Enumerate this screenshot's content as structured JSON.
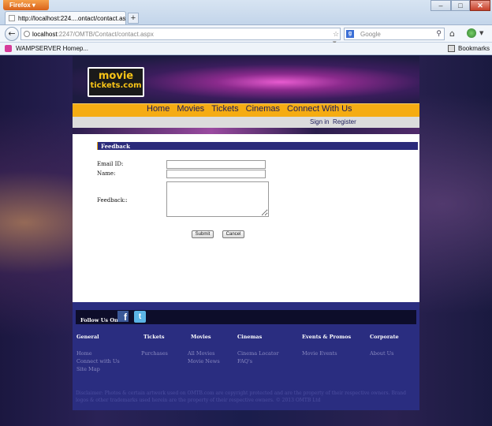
{
  "browser": {
    "menu_button": "Firefox",
    "tab_title": "http://localhost:224....ontact/contact.aspx",
    "new_tab": "+",
    "url_host": "localhost",
    "url_path": ":2247/OMTB/Contact/contact.aspx",
    "search_placeholder": "Google",
    "search_engine_icon": "google-icon",
    "bookmark_item": "WAMPSERVER Homep...",
    "bookmarks_label": "Bookmarks"
  },
  "site": {
    "logo_line1": "movie",
    "logo_line2": "tickets.com",
    "nav": [
      "Home",
      "Movies",
      "Tickets",
      "Cinemas",
      "Connect With Us"
    ],
    "sign_in": "Sign in",
    "register": "Register",
    "accent_color": "#f5ac13",
    "brand_navy": "#2a2d80"
  },
  "form": {
    "title": "Feedback",
    "email_label": "Email ID:",
    "name_label": "Name:",
    "feedback_label": "Feedback::",
    "email_value": "",
    "name_value": "",
    "feedback_value": "",
    "submit_label": "Submit",
    "cancel_label": "Cancel"
  },
  "footer": {
    "follow_label": "Follow Us On",
    "facebook_icon": "facebook-icon",
    "twitter_icon": "twitter-icon",
    "columns": [
      {
        "heading": "General",
        "links": [
          "Home",
          "Connect with Us",
          "Site Map"
        ]
      },
      {
        "heading": "Tickets",
        "links": [
          "Purchases"
        ]
      },
      {
        "heading": "Movies",
        "links": [
          "All Movies",
          "Movie News"
        ]
      },
      {
        "heading": "Cinemas",
        "links": [
          "Cinema Locator",
          "FAQ's"
        ]
      },
      {
        "heading": "Events & Promos",
        "links": [
          "Movie Events"
        ]
      },
      {
        "heading": "Corporate",
        "links": [
          "About Us"
        ]
      }
    ],
    "disclaimer": "Disclaimer: Photos & certain artwork used on OMTB.com are copyright protected and are the property of their respective owners. Brand logos & other trademarks used herein are the property of their respective owners. © 2013 OMTB Ltd"
  }
}
